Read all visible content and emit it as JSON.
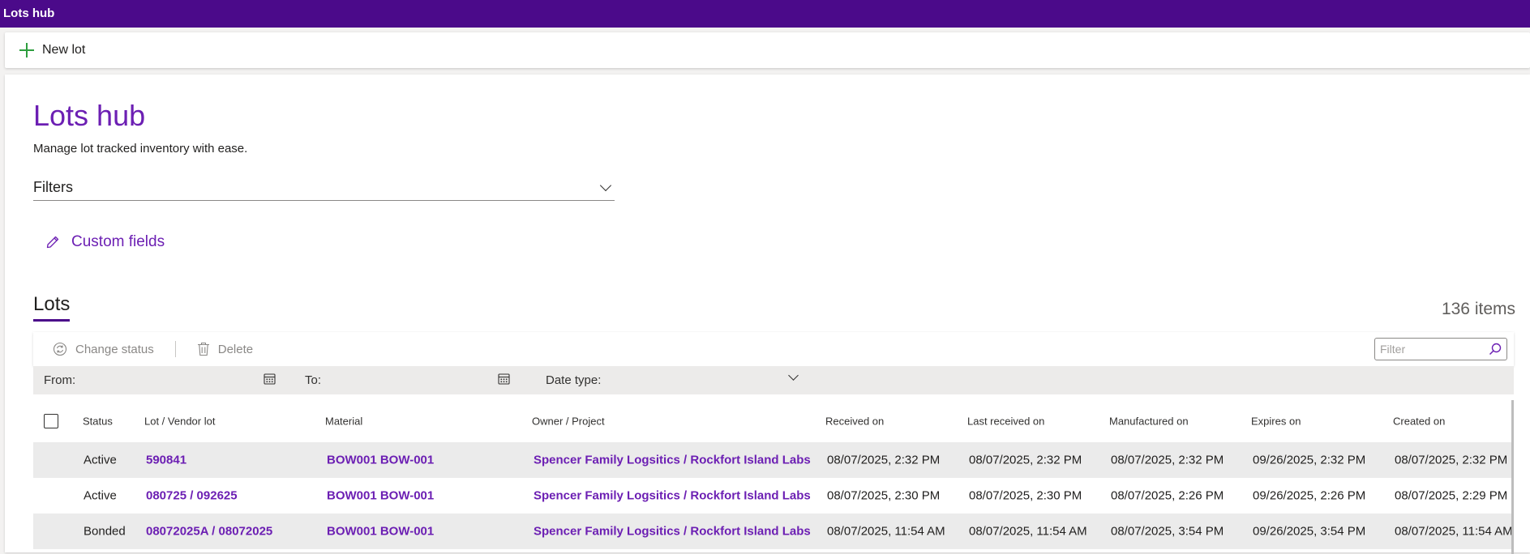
{
  "app": {
    "title": "Lots hub"
  },
  "command_bar": {
    "new_lot_label": "New lot"
  },
  "page": {
    "title": "Lots hub",
    "subtitle": "Manage lot tracked inventory with ease.",
    "filters_label": "Filters",
    "custom_fields_label": "Custom fields"
  },
  "lots": {
    "tab_label": "Lots",
    "items_count": "136 items",
    "toolbar": {
      "change_status_label": "Change status",
      "delete_label": "Delete",
      "filter_placeholder": "Filter"
    },
    "date_filter": {
      "from_label": "From:",
      "to_label": "To:",
      "date_type_label": "Date type:"
    },
    "columns": {
      "status": "Status",
      "lot": "Lot / Vendor lot",
      "material": "Material",
      "owner": "Owner / Project",
      "received": "Received on",
      "last_received": "Last received on",
      "manufactured": "Manufactured on",
      "expires": "Expires on",
      "created": "Created on"
    },
    "rows": [
      {
        "status": "Active",
        "lot": "590841",
        "material": "BOW001 BOW-001",
        "owner": "Spencer Family Logsitics / Rockfort Island Labs",
        "received": "08/07/2025, 2:32 PM",
        "last_received": "08/07/2025, 2:32 PM",
        "manufactured": "08/07/2025, 2:32 PM",
        "expires": "09/26/2025, 2:32 PM",
        "created": "08/07/2025, 2:32 PM"
      },
      {
        "status": "Active",
        "lot": "080725 / 092625",
        "material": "BOW001 BOW-001",
        "owner": "Spencer Family Logsitics / Rockfort Island Labs",
        "received": "08/07/2025, 2:30 PM",
        "last_received": "08/07/2025, 2:30 PM",
        "manufactured": "08/07/2025, 2:26 PM",
        "expires": "09/26/2025, 2:26 PM",
        "created": "08/07/2025, 2:29 PM"
      },
      {
        "status": "Bonded",
        "lot": "08072025A / 08072025",
        "material": "BOW001 BOW-001",
        "owner": "Spencer Family Logsitics / Rockfort Island Labs",
        "received": "08/07/2025, 11:54 AM",
        "last_received": "08/07/2025, 11:54 AM",
        "manufactured": "08/07/2025, 3:54 PM",
        "expires": "09/26/2025, 3:54 PM",
        "created": "08/07/2025, 11:54 AM"
      }
    ]
  },
  "colors": {
    "brand": "#4b0a8a",
    "accent": "#6c1fb3",
    "add": "#2e9e3f"
  }
}
